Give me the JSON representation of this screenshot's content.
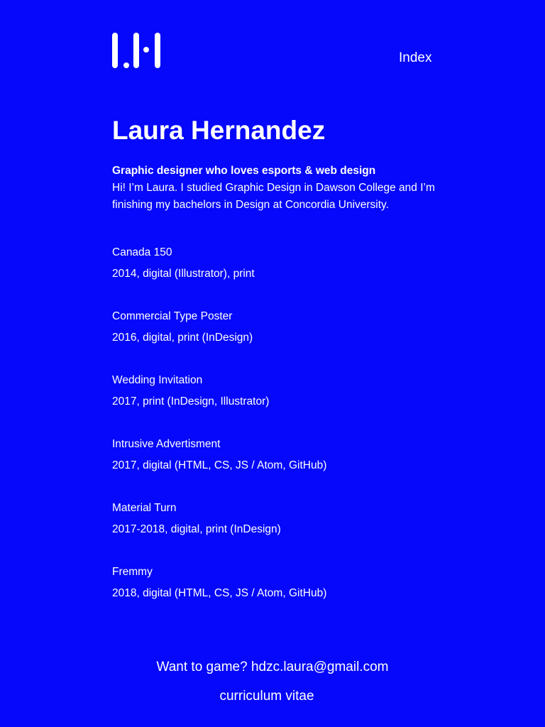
{
  "nav": {
    "index_label": "Index"
  },
  "header": {
    "logo_icon": "lh-monogram-logo",
    "name": "Laura Hernandez"
  },
  "intro": {
    "tagline": "Graphic designer who loves esports & web design",
    "bio": "Hi! I’m Laura. I studied Graphic Design in Dawson College and I’m finishing my bachelors in Design at Concordia University."
  },
  "projects": [
    {
      "title": "Canada 150",
      "meta": "2014, digital (Illustrator), print"
    },
    {
      "title": "Commercial Type Poster",
      "meta": "2016, digital, print (InDesign)"
    },
    {
      "title": "Wedding Invitation",
      "meta": "2017, print (InDesign, Illustrator)"
    },
    {
      "title": "Intrusive Advertisment",
      "meta": "2017, digital (HTML, CS, JS / Atom, GitHub)"
    },
    {
      "title": "Material Turn",
      "meta": "2017-2018, digital, print (InDesign)"
    },
    {
      "title": "Fremmy",
      "meta": "2018, digital (HTML, CS, JS / Atom, GitHub)"
    }
  ],
  "footer": {
    "contact_prompt": "Want to game?",
    "email": "hdzc.laura@gmail.com",
    "cv_label": "curriculum vitae"
  },
  "colors": {
    "background": "#0508fa",
    "text": "#ffffff"
  }
}
